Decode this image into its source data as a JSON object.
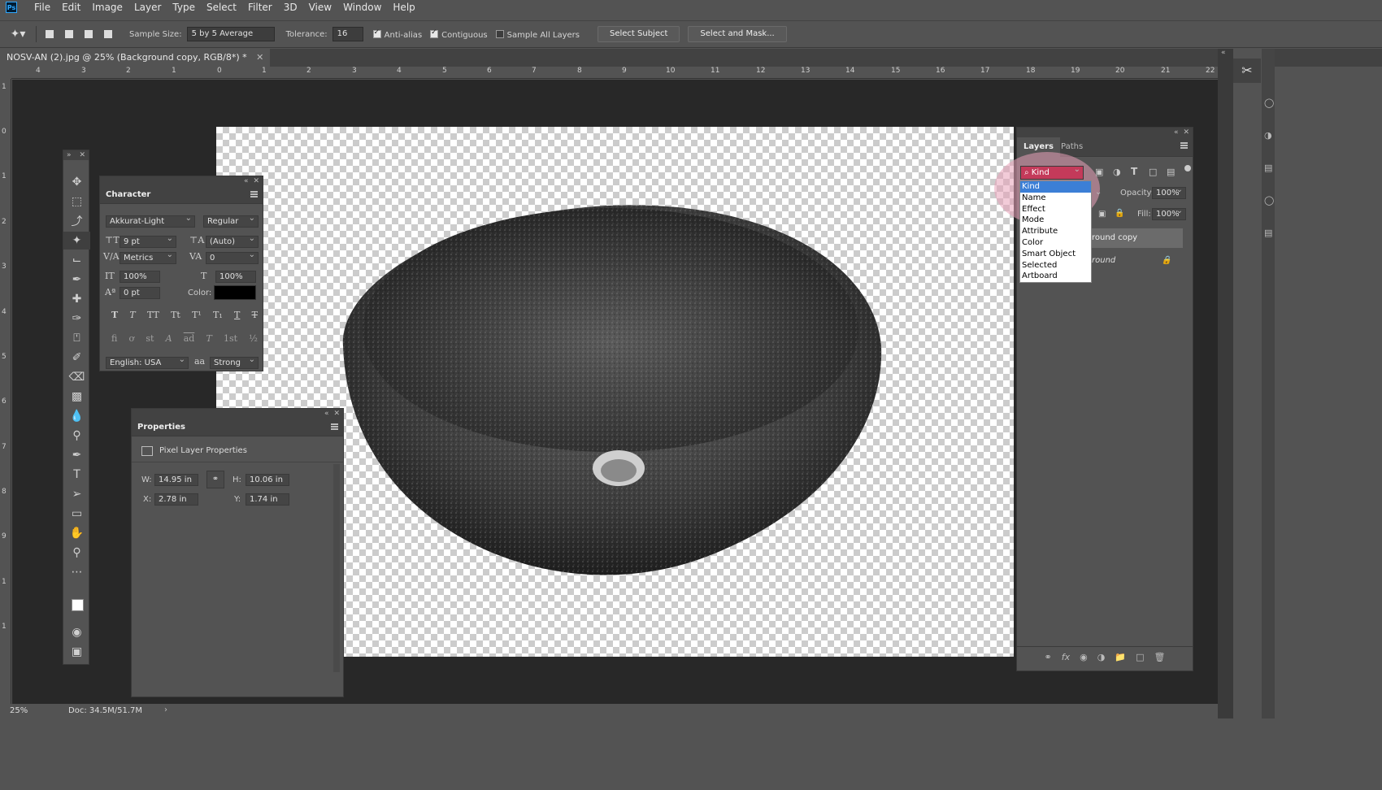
{
  "menubar": {
    "logo": "Ps",
    "items": [
      "File",
      "Edit",
      "Image",
      "Layer",
      "Type",
      "Select",
      "Filter",
      "3D",
      "View",
      "Window",
      "Help"
    ]
  },
  "options": {
    "sample_size_label": "Sample Size:",
    "sample_size_value": "5 by 5 Average",
    "tolerance_label": "Tolerance:",
    "tolerance_value": "16",
    "anti_alias": "Anti-alias",
    "contiguous": "Contiguous",
    "sample_all_layers": "Sample All Layers",
    "select_subject": "Select Subject",
    "select_and_mask": "Select and Mask..."
  },
  "document": {
    "tab": "NOSV-AN (2).jpg @ 25% (Background copy, RGB/8*) *",
    "zoom": "25%",
    "doc_info": "Doc: 34.5M/51.7M"
  },
  "ruler_h": [
    "4",
    "3",
    "2",
    "1",
    "0",
    "1",
    "2",
    "3",
    "4",
    "5",
    "6",
    "7",
    "8",
    "9",
    "10",
    "11",
    "12",
    "13",
    "14",
    "15",
    "16",
    "17",
    "18",
    "19",
    "20",
    "21",
    "22"
  ],
  "ruler_v": [
    "1",
    "0",
    "1",
    "2",
    "3",
    "4",
    "5",
    "6",
    "7",
    "8",
    "9",
    "1",
    "1"
  ],
  "character": {
    "title": "Character",
    "font": "Akkurat-Light",
    "style": "Regular",
    "size": "9 pt",
    "leading": "(Auto)",
    "kerning": "Metrics",
    "tracking": "0",
    "vscale": "100%",
    "hscale": "100%",
    "baseline": "0 pt",
    "color_label": "Color:",
    "language": "English: USA",
    "aa": "Strong",
    "aa_icon": "aa",
    "type_styles": [
      "T",
      "T",
      "TT",
      "Tt",
      "T¹",
      "T₁",
      "T",
      "T"
    ],
    "ot_features": [
      "fi",
      "ơ",
      "st",
      "A",
      "ad",
      "T",
      "1st",
      "½"
    ]
  },
  "properties": {
    "title": "Properties",
    "subtitle": "Pixel Layer Properties",
    "w_label": "W:",
    "w": "14.95 in",
    "h_label": "H:",
    "h": "10.06 in",
    "x_label": "X:",
    "x": "2.78 in",
    "y_label": "Y:",
    "y": "1.74 in"
  },
  "layers": {
    "tab_layers": "Layers",
    "tab_paths": "Paths",
    "filter": "Kind",
    "opacity_label": "Opacity:",
    "opacity": "100%",
    "fill_label": "Fill:",
    "fill": "100%",
    "rows": [
      "round copy",
      "round"
    ]
  },
  "kind_menu": {
    "options": [
      "Kind",
      "Name",
      "Effect",
      "Mode",
      "Attribute",
      "Color",
      "Smart Object",
      "Selected",
      "Artboard"
    ],
    "selected": "Kind"
  },
  "colors": {
    "accent": "#3c7fd6",
    "highlight": "#e8a0b8"
  }
}
